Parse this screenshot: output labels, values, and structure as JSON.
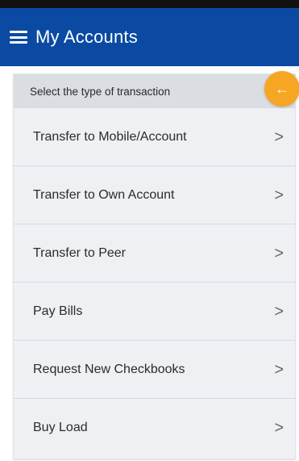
{
  "app_bar": {
    "title": "My Accounts",
    "menu_icon": "hamburger-menu-icon",
    "background": "#0b4aa2"
  },
  "card": {
    "header": "Select the type of transaction",
    "back_icon": "arrow-left-icon",
    "back_glyph": "←",
    "accent": "#f7a623"
  },
  "transactions": [
    {
      "label": "Transfer to Mobile/Account",
      "chevron": ">"
    },
    {
      "label": "Transfer to Own Account",
      "chevron": ">"
    },
    {
      "label": "Transfer to Peer",
      "chevron": ">"
    },
    {
      "label": "Pay Bills",
      "chevron": ">"
    },
    {
      "label": "Request New Checkbooks",
      "chevron": ">"
    },
    {
      "label": "Buy Load",
      "chevron": ">"
    }
  ]
}
